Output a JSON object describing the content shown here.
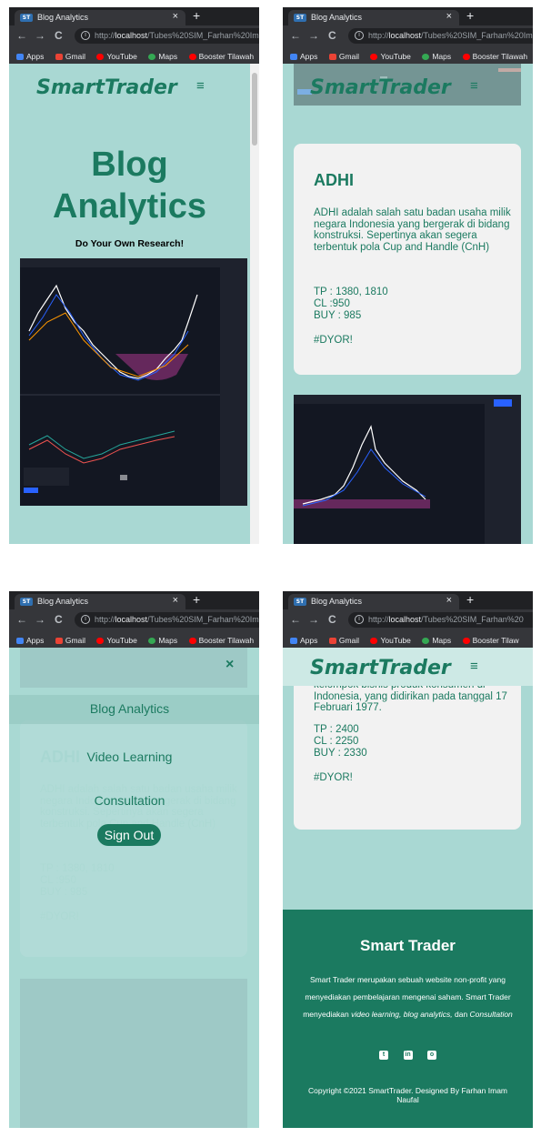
{
  "browser": {
    "tab_favicon": "ST",
    "tab_title": "Blog Analytics",
    "tab_close": "×",
    "new_tab": "+",
    "back": "←",
    "forward": "→",
    "reload": "C",
    "url_scheme": "http://",
    "url_host": "localhost",
    "url_path_a": "/Tubes%20SIM_Farhan%20Im",
    "url_path_b": "/Tubes%20SIM_Farhan%20",
    "bookmarks": [
      "Apps",
      "Gmail",
      "YouTube",
      "Maps",
      "Booster Tilawah"
    ],
    "bookmarks_p4": [
      "Apps",
      "Gmail",
      "YouTube",
      "Maps",
      "Booster Tilaw"
    ]
  },
  "header": {
    "brand": "SmartTrader",
    "menu_icon": "≡"
  },
  "hero": {
    "title_line1": "Blog",
    "title_line2": "Analytics",
    "tagline": "Do Your Own Research!"
  },
  "post_adhi": {
    "title": "ADHI",
    "description": "ADHI adalah salah satu badan usaha milik negara Indonesia yang bergerak di bidang konstruksi. Sepertinya akan segera terbentuk pola Cup and Handle (CnH)",
    "tp": "TP : 1380, 1810",
    "cl": "CL :950",
    "buy": "BUY : 985",
    "hashtag": "#DYOR!"
  },
  "post_myor": {
    "description": "PT Mayora Indah Tbk atau Mayora Indah serta Mayora Group adalah salah satu kelompok bisnis produk konsumen di Indonesia, yang didirikan pada tanggal 17 Februari 1977.",
    "tp": "TP : 2400",
    "cl": "CL : 2250",
    "buy": "BUY : 2330",
    "hashtag": "#DYOR!"
  },
  "mobile_menu": {
    "close": "×",
    "items": [
      "Blog Analytics",
      "Video Learning",
      "Consultation"
    ],
    "sign_out": "Sign Out"
  },
  "footer": {
    "title": "Smart Trader",
    "desc_line1": "Smart Trader merupakan sebuah website non-profit yang",
    "desc_line2": "menyediakan pembelajaran mengenai saham. Smart Trader",
    "desc_line3a": "menyediakan ",
    "desc_line3b": "video learning, blog analytics,",
    "desc_line3c": " dan ",
    "desc_line3d": "Consultation",
    "social": [
      "twitter-icon",
      "linkedin-icon",
      "instagram-icon"
    ],
    "copyright_line1": "Copyright ©2021 SmartTrader. Designed By Farhan Imam",
    "copyright_line2": "Naufal"
  },
  "colors": {
    "brand_green": "#1b7a60",
    "page_bg": "#a9d8d3",
    "card_bg": "#f2f2f2",
    "chart_bg": "#131722",
    "chrome_dark": "#202124"
  }
}
